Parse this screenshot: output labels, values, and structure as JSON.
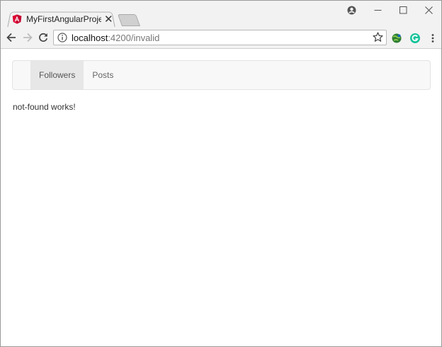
{
  "browser": {
    "tab": {
      "title": "MyFirstAngularProject",
      "close_label": "✕"
    },
    "window_controls": {
      "minimize": "—",
      "maximize": "☐",
      "close": "✕"
    },
    "address_bar": {
      "host": "localhost",
      "path": ":4200/invalid"
    }
  },
  "app": {
    "nav_items": [
      {
        "label": "Followers",
        "active": true
      },
      {
        "label": "Posts",
        "active": false
      }
    ],
    "message": "not-found works!"
  },
  "colors": {
    "angular_red": "#dd0031",
    "grammarly_green": "#15c39a"
  }
}
